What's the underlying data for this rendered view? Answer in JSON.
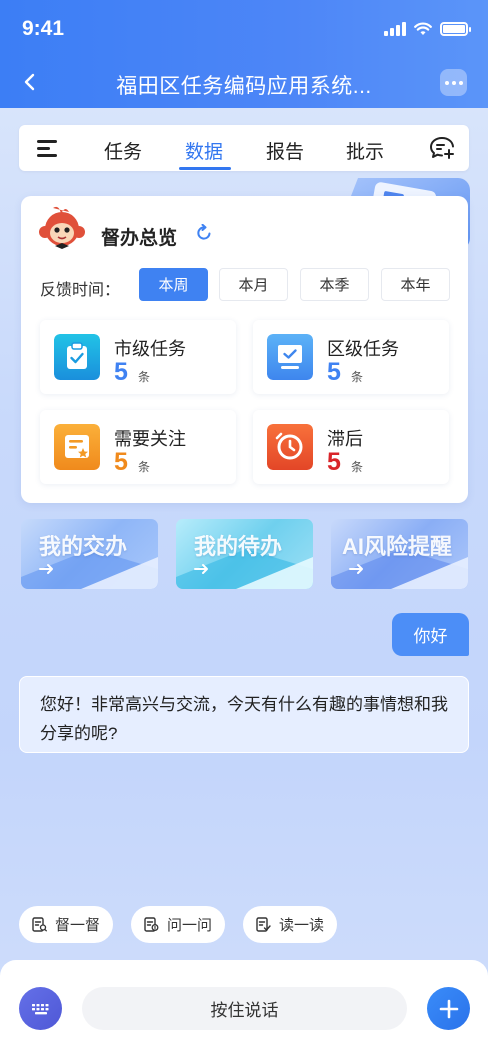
{
  "status_bar": {
    "time": "9:41"
  },
  "nav": {
    "title": "福田区任务编码应用系统..."
  },
  "tabs": [
    {
      "label": "任务",
      "active": false
    },
    {
      "label": "数据",
      "active": true
    },
    {
      "label": "报告",
      "active": false
    },
    {
      "label": "批示",
      "active": false
    }
  ],
  "overview": {
    "title": "督办总览",
    "feedback_label": "反馈时间：",
    "periods": [
      {
        "label": "本周",
        "active": true
      },
      {
        "label": "本月",
        "active": false
      },
      {
        "label": "本季",
        "active": false
      },
      {
        "label": "本年",
        "active": false
      }
    ],
    "stats": [
      {
        "name": "市级任务",
        "value": "5",
        "unit": "条",
        "color": "#3f82f2"
      },
      {
        "name": "区级任务",
        "value": "5",
        "unit": "条",
        "color": "#3f82f2"
      },
      {
        "name": "需要关注",
        "value": "5",
        "unit": "条",
        "color": "#f08a1c"
      },
      {
        "name": "滞后",
        "value": "5",
        "unit": "条",
        "color": "#d9252a"
      }
    ]
  },
  "shortcuts": [
    {
      "label": "我的交办"
    },
    {
      "label": "我的待办"
    },
    {
      "label": "AI风险提醒"
    }
  ],
  "chat": {
    "user_message": "你好",
    "ai_message": "您好！非常高兴与交流，今天有什么有趣的事情想和我分享的呢?"
  },
  "quick_actions": [
    {
      "label": "督一督",
      "icon": "supervise-icon"
    },
    {
      "label": "问一问",
      "icon": "ask-icon"
    },
    {
      "label": "读一读",
      "icon": "read-icon"
    }
  ],
  "input": {
    "hold_to_talk": "按住说话"
  },
  "colors": {
    "accent": "#3377f0",
    "header": "#3c7ef5",
    "warn": "#f08a1c",
    "danger": "#d9252a"
  }
}
